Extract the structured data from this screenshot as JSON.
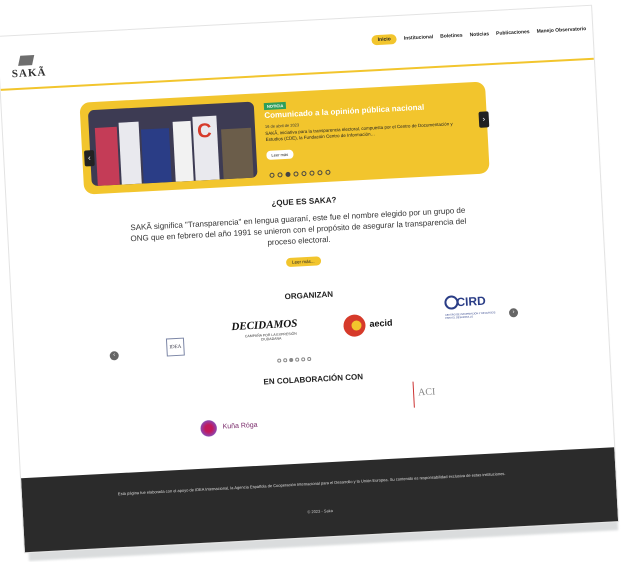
{
  "header": {
    "logo_text": "SAKÃ",
    "nav": [
      "Inicio",
      "Institucional",
      "Boletines",
      "Noticias",
      "Publicaciones",
      "Manejo Observatorio"
    ]
  },
  "carousel": {
    "badge": "NOTICIA",
    "title": "Comunicado a la opinión pública nacional",
    "date": "16 de abril de 2023",
    "excerpt": "SAKÃ, iniciativa para la transparencia electoral, compuesta por el Centro de Documentación y Estudios (CDE), la Fundación Centro de Información…",
    "button": "Leer más",
    "slides_count": 8,
    "active_slide": 3,
    "prev_icon": "chevron-left-icon",
    "next_icon": "chevron-right-icon"
  },
  "about": {
    "heading": "¿QUE ES SAKA?",
    "text": "SAKÃ significa \"Transparencia\" en lengua guaraní, este fue el nombre elegido por un grupo de ONG que en febrero del año 1991 se unieron con el propósito de asegurar la transparencia del proceso electoral.",
    "button": "Leer más..."
  },
  "organizan": {
    "heading": "ORGANIZAN",
    "logos": {
      "idea": "IDEA",
      "decidamos": "DECIDAMOS",
      "decidamos_sub": "CAMPAÑA POR LA EXPRESIÓN CIUDADANA",
      "aecid": "aecid",
      "cird": "CIRD",
      "cird_sub": "CENTRO DE INFORMACIÓN Y RECURSOS PARA EL DESARROLLO"
    },
    "dots_count": 6,
    "active_dot": 3
  },
  "colaboracion": {
    "heading": "EN COLABORACIÓN CON",
    "logos": {
      "kuna": "Kuña Róga",
      "aci": "ACI"
    }
  },
  "footer": {
    "text": "Esta página fue elaborada con el apoyo de IDEA Internacional, la Agencia Española de Cooperación Internacional para el Desarrollo y la Unión Europea. Su contenido es responsabilidad exclusiva de estas instituciones.",
    "copyright": "© 2023 - Saka"
  },
  "colors": {
    "accent": "#f2c52d",
    "footer_bg": "#2b2b2b"
  }
}
